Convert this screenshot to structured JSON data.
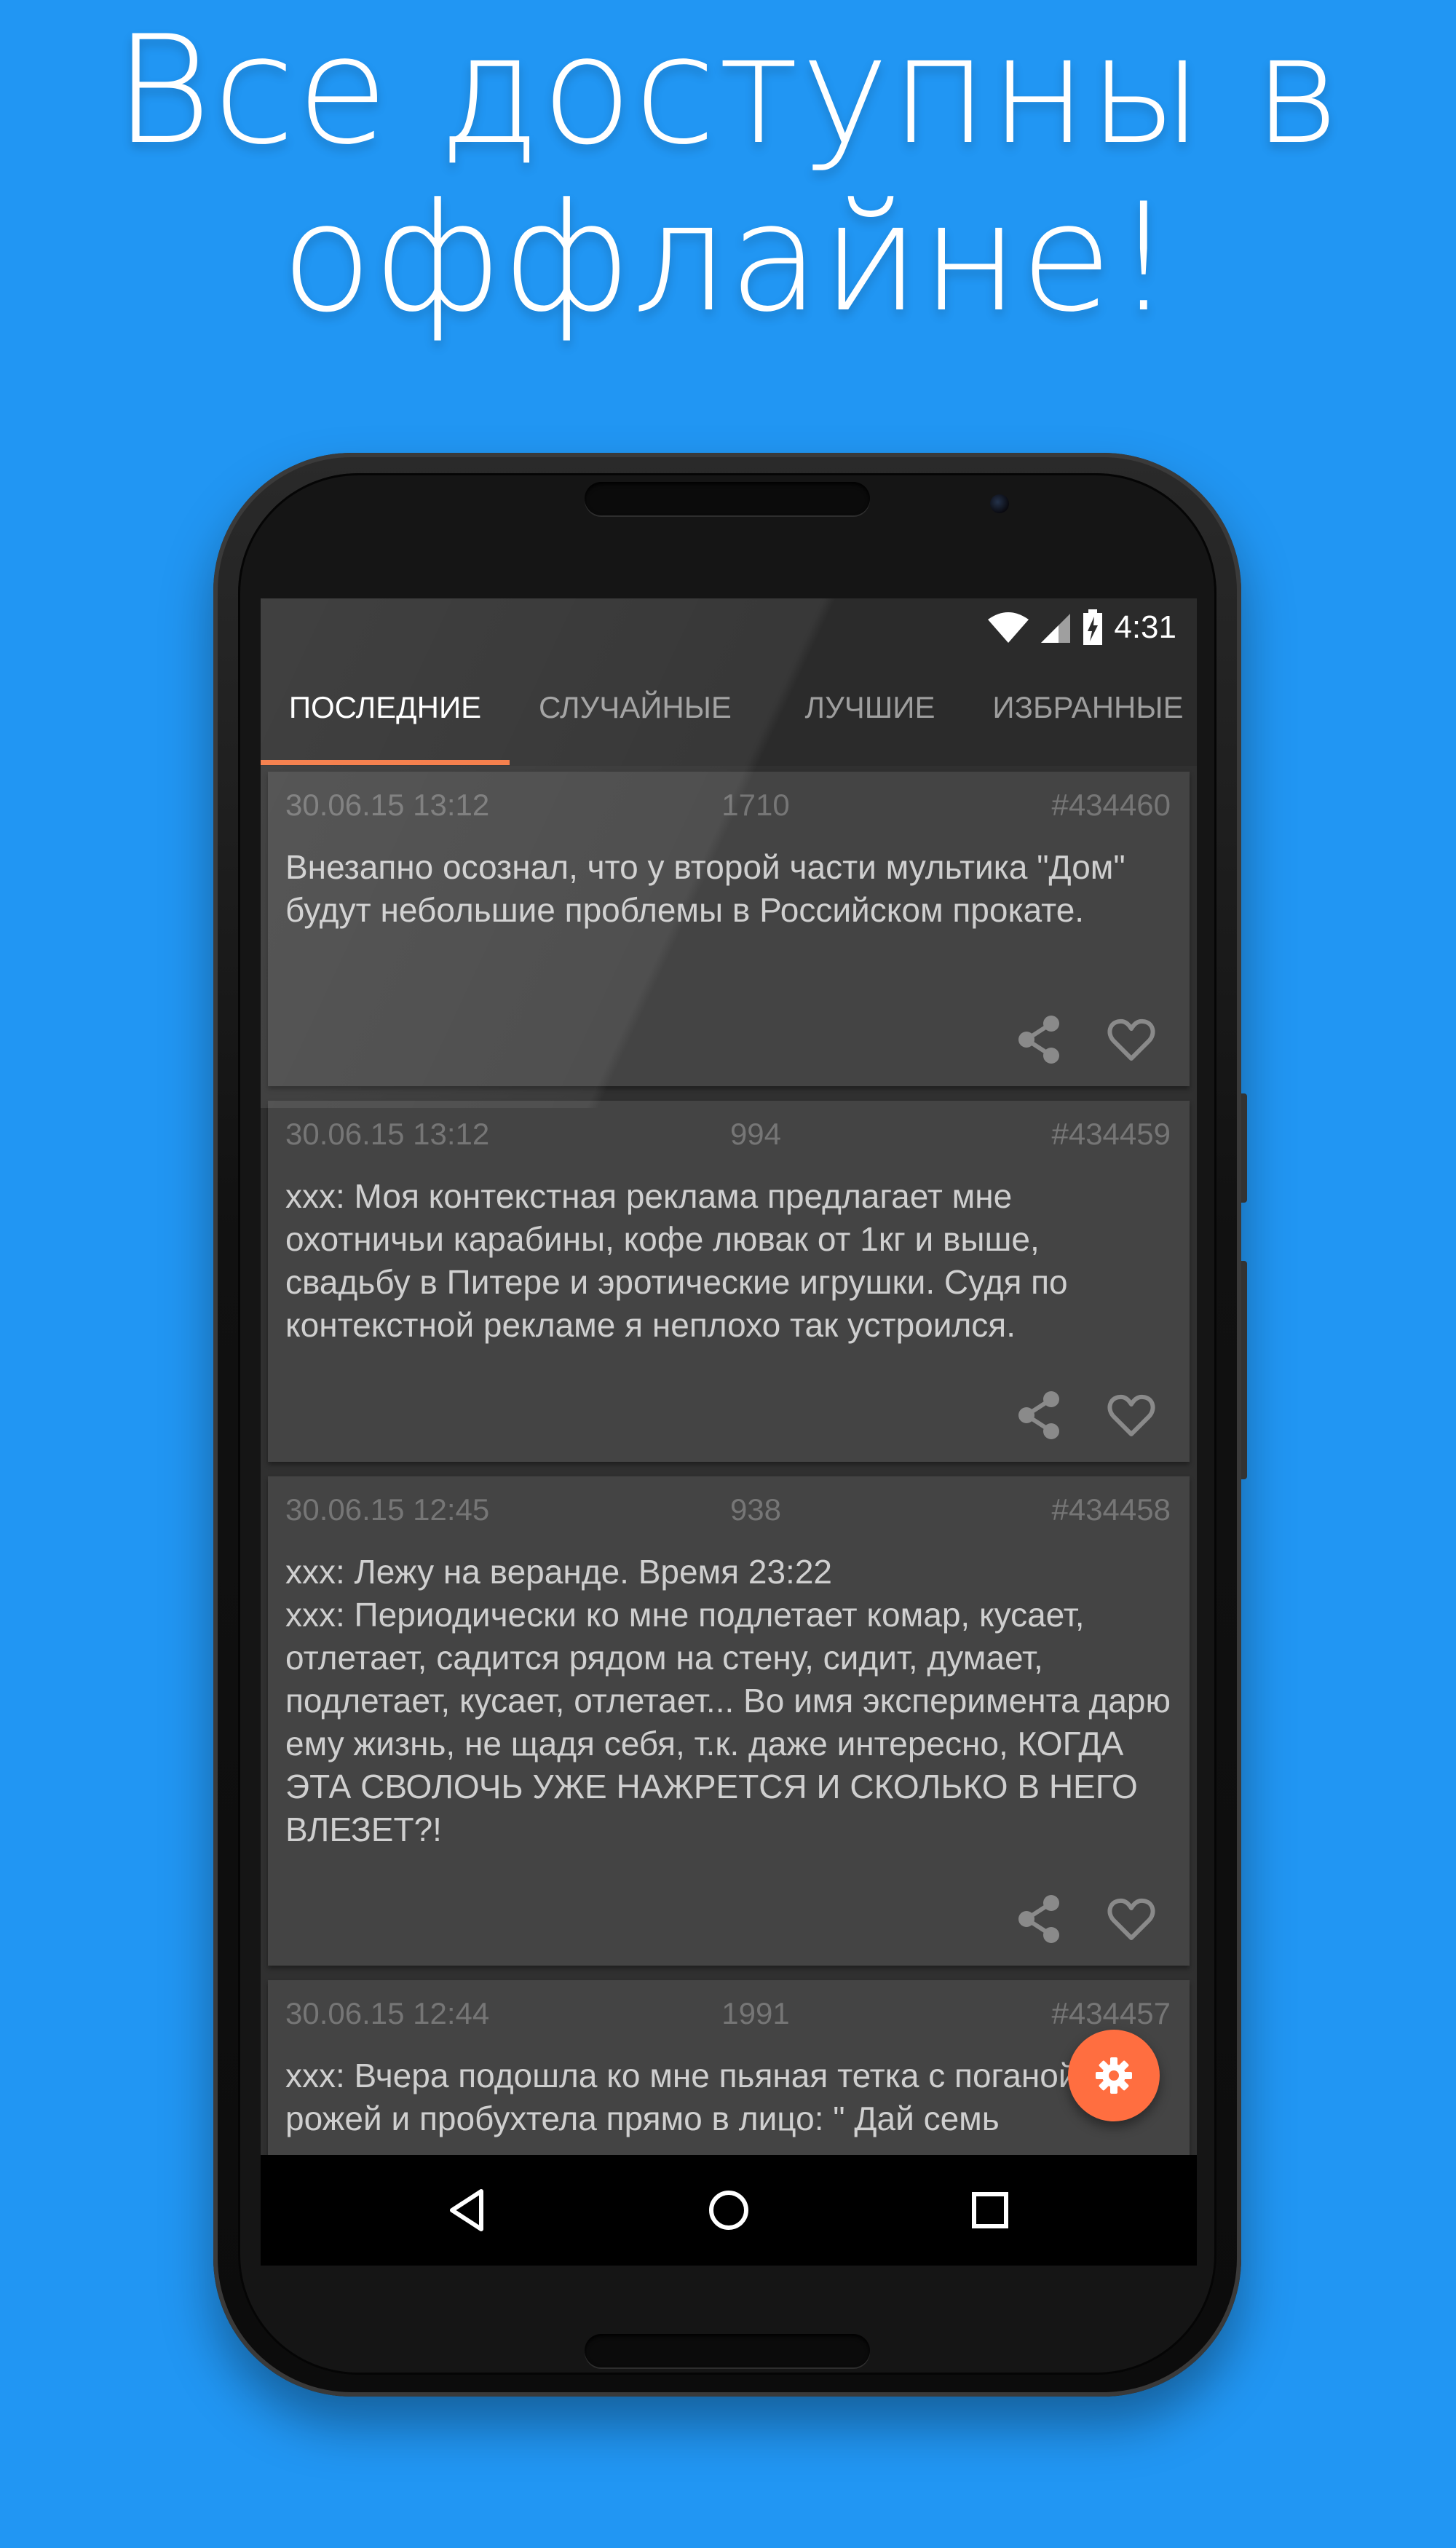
{
  "promo": {
    "headline_line1": "Все доступны в",
    "headline_line2": "оффлайне!"
  },
  "status_bar": {
    "time": "4:31",
    "icons": [
      "wifi-icon",
      "cell-signal-icon",
      "battery-charging-icon"
    ]
  },
  "tabs": [
    {
      "label": "ПОСЛЕДНИЕ",
      "active": true
    },
    {
      "label": "СЛУЧАЙНЫЕ",
      "active": false
    },
    {
      "label": "ЛУЧШИЕ",
      "active": false
    },
    {
      "label": "ИЗБРАННЫЕ",
      "active": false
    }
  ],
  "quotes": [
    {
      "date": "30.06.15 13:12",
      "rating": "1710",
      "id": "#434460",
      "text": "Внезапно осознал, что у второй части мультика \"Дом\" будут небольшие проблемы в Российском прокате."
    },
    {
      "date": "30.06.15 13:12",
      "rating": "994",
      "id": "#434459",
      "text": "xxx: Моя контекстная реклама предлагает мне охотничьи карабины, кофе лювак от 1кг и выше, свадьбу в Питере и эротические игрушки. Судя по контекстной рекламе я неплохо так устроился."
    },
    {
      "date": "30.06.15 12:45",
      "rating": "938",
      "id": "#434458",
      "text": "xxx: Лежу на веранде. Время 23:22\nxxx: Периодически ко мне подлетает комар, кусает, отлетает, садится рядом на стену, сидит, думает, подлетает, кусает, отлетает... Во имя эксперимента дарю ему жизнь, не щадя себя, т.к. даже интересно, КОГДА ЭТА СВОЛОЧЬ УЖЕ НАЖРЕТСЯ И СКОЛЬКО В НЕГО ВЛЕЗЕТ?!"
    },
    {
      "date": "30.06.15 12:44",
      "rating": "1991",
      "id": "#434457",
      "text": "xxx: Вчера подошла ко мне пьяная тетка с поганой рожей и пробухтела прямо в лицо: \" Дай семь"
    }
  ],
  "actions": {
    "share_icon": "share-icon",
    "favorite_icon": "heart-outline-icon"
  },
  "fab": {
    "icon": "gear-icon",
    "color": "#FF6E40"
  },
  "nav_bar": {
    "icons": [
      "back-icon",
      "home-icon",
      "recents-icon"
    ]
  },
  "colors": {
    "background": "#2196F3",
    "tab_indicator": "#F4753E",
    "card": "#444444"
  }
}
